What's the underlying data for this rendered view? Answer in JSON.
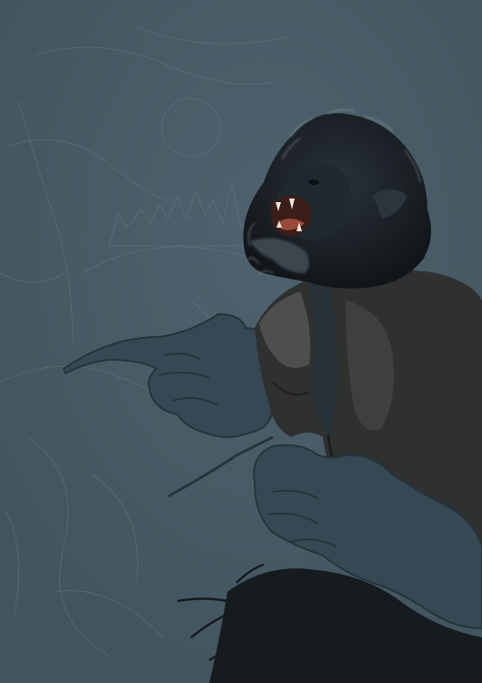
{
  "artwork": {
    "subject": "werewolf-painting",
    "colors": {
      "background": "#455863",
      "background_light": "#4d616c",
      "sketch_line": "#6a7d87",
      "fur_dark": "#141a1f",
      "fur_mid": "#2a3238",
      "fur_highlight": "#b9c3c8",
      "jacket": "#2e3130",
      "jacket_light": "#4c4f4b",
      "hand_fill": "#364854",
      "hand_line": "#26343d",
      "mouth": "#e8e6de",
      "tongue": "#9a4a3c"
    }
  }
}
